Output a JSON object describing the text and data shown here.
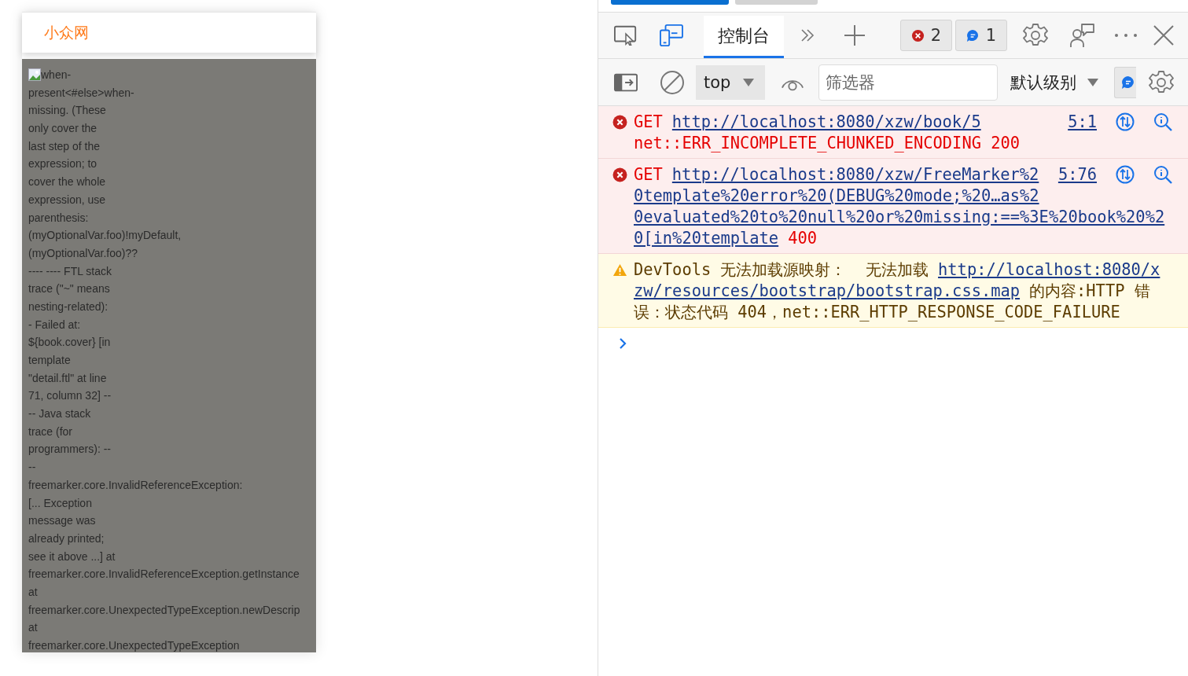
{
  "page": {
    "logo": "小众网",
    "lines": [
      "when-",
      "present<#else>when-",
      "missing. (These",
      "only cover the",
      "last step of the",
      "expression; to",
      "cover the whole",
      "expression, use",
      "parenthesis:",
      "(myOptionalVar.foo)!myDefault,",
      "(myOptionalVar.foo)??",
      "---- ---- FTL stack",
      "trace (\"~\" means",
      "nesting-related):",
      "- Failed at:",
      "${book.cover} [in",
      "template",
      "\"detail.ftl\" at line",
      "71, column 32] --",
      "-- Java stack",
      "trace (for",
      "programmers): --",
      "--",
      "freemarker.core.InvalidReferenceException:",
      "[... Exception",
      "message was",
      "already printed;",
      "see it above ...] at",
      "freemarker.core.InvalidReferenceException.getInstance",
      "at",
      "freemarker.core.UnexpectedTypeException.newDescrip",
      "at",
      "freemarker.core.UnexpectedTypeException"
    ]
  },
  "devtools": {
    "tabs": [
      {
        "label": "控制台",
        "selected": true
      }
    ],
    "error_count": "2",
    "message_count": "1",
    "context": "top",
    "filter": {
      "placeholder": "筛选器"
    },
    "level_select": "默认级别",
    "messages": [
      {
        "kind": "error",
        "source": "5:1",
        "lines": [
          [
            {
              "kind": "method",
              "text": "GET"
            },
            {
              "kind": "url",
              "text": "http://localhost:8080/xzw/book/5"
            }
          ],
          [
            {
              "kind": "text",
              "text": "net::ERR_INCOMPLETE_CHUNKED_ENCODING 200"
            }
          ]
        ]
      },
      {
        "kind": "error",
        "source": "5:76",
        "lines": [
          [
            {
              "kind": "method",
              "text": "GET"
            },
            {
              "kind": "url",
              "text": "http://localhost:8080/xzw/FreeMarker%2"
            }
          ],
          [
            {
              "kind": "url",
              "text": "0template%20error%20(DEBUG%20mode;%20…as%2"
            }
          ],
          [
            {
              "kind": "url",
              "text": "0evaluated%20to%20null%20or%20missing:==%3E%20book%20%2"
            }
          ],
          [
            {
              "kind": "url",
              "text": "0[in%20template"
            },
            {
              "kind": "text",
              "text": "400"
            }
          ]
        ]
      },
      {
        "kind": "warning",
        "lines": [
          [
            {
              "kind": "text",
              "text": "DevTools 无法加载源映射：  无法加载"
            },
            {
              "kind": "url",
              "text": "http://localhost:8080/x"
            }
          ],
          [
            {
              "kind": "url",
              "text": "zw/resources/bootstrap/bootstrap.css.map"
            },
            {
              "kind": "text",
              "text": "的内容:HTTP 错"
            }
          ],
          [
            {
              "kind": "text",
              "text": "误：状态代码 404，net::ERR_HTTP_RESPONSE_CODE_FAILURE"
            }
          ]
        ]
      }
    ]
  }
}
